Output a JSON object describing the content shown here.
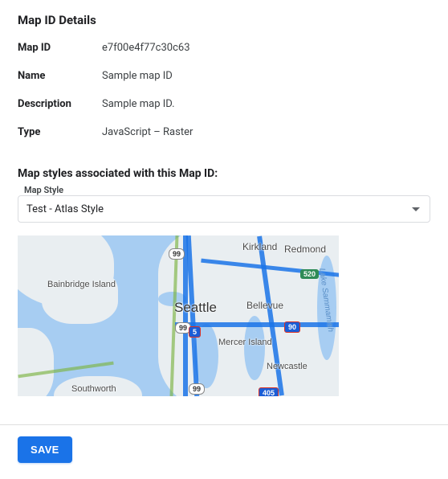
{
  "section_title": "Map ID Details",
  "details": {
    "mapid_label": "Map ID",
    "mapid_value": "e7f00e4f77c30c63",
    "name_label": "Name",
    "name_value": "Sample map ID",
    "desc_label": "Description",
    "desc_value": "Sample map ID.",
    "type_label": "Type",
    "type_value": "JavaScript – Raster"
  },
  "assoc_title": "Map styles associated with this Map ID:",
  "style_field_label": "Map Style",
  "style_selected": "Test - Atlas Style",
  "map_labels": {
    "seattle": "Seattle",
    "bellevue": "Bellevue",
    "kirkland": "Kirkland",
    "redmond": "Redmond",
    "bainbridge": "Bainbridge Island",
    "mercer": "Mercer Island",
    "newcastle": "Newcastle",
    "southworth": "Southworth",
    "lake": "Lake Sammamish"
  },
  "shields": {
    "s99a": "99",
    "s99b": "99",
    "s99c": "99",
    "i5": "5",
    "i90": "90",
    "s520": "520",
    "i405": "405"
  },
  "save_label": "SAVE"
}
